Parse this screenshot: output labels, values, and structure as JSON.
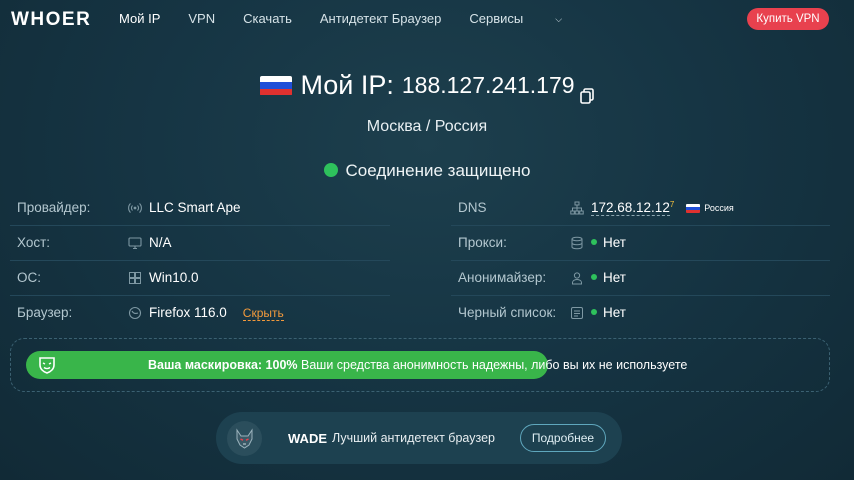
{
  "header": {
    "logo": "WHOER",
    "nav": [
      "Мой IP",
      "VPN",
      "Скачать",
      "Антидетект Браузер",
      "Сервисы"
    ],
    "buy_label": "Купить VPN"
  },
  "hero": {
    "ip_label": "Мой IP:",
    "ip": "188.127.241.179",
    "location": "Москва / Россия",
    "status": "Соединение защищено"
  },
  "info_left": [
    {
      "label": "Провайдер:",
      "value": "LLC Smart Ape",
      "icon": "wifi-icon"
    },
    {
      "label": "Хост:",
      "value": "N/A",
      "icon": "monitor-icon"
    },
    {
      "label": "ОС:",
      "value": "Win10.0",
      "icon": "windows-icon"
    },
    {
      "label": "Браузер:",
      "value": "Firefox 116.0",
      "icon": "browser-icon",
      "link": "Скрыть"
    }
  ],
  "info_right": [
    {
      "label": "DNS",
      "value": "172.68.12.12",
      "sup": "7",
      "country": "Россия",
      "icon": "network-icon"
    },
    {
      "label": "Прокси:",
      "value": "Нет",
      "icon": "database-icon"
    },
    {
      "label": "Анонимайзер:",
      "value": "Нет",
      "icon": "person-icon"
    },
    {
      "label": "Черный список:",
      "value": "Нет",
      "icon": "list-icon"
    }
  ],
  "mask": {
    "percent": 100,
    "title": "Ваша маскировка: 100%",
    "text": "Ваши средства анонимность надежны, либо вы их не используете"
  },
  "wade": {
    "title": "WADE",
    "desc": "Лучший антидетект браузер",
    "button": "Подробнее"
  },
  "colors": {
    "background": "#163544",
    "accent_red": "#e8414e",
    "green": "#2ec15c",
    "orange_link": "#f39a3c"
  }
}
